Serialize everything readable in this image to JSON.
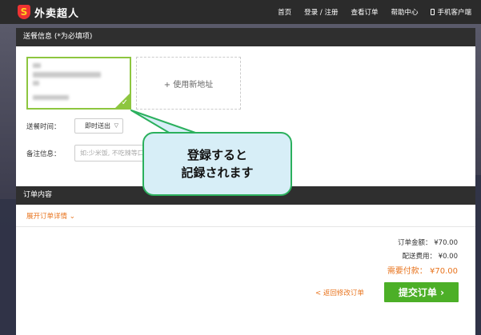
{
  "header": {
    "logo_glyph": "S",
    "logo_text": "外卖超人",
    "nav": [
      "首页",
      "登录 / 注册",
      "查看订单",
      "帮助中心",
      "手机客户端"
    ]
  },
  "delivery": {
    "section_title": "送餐信息 (*为必填项)",
    "new_address": "+ 使用新地址",
    "time_label": "送餐时间：",
    "time_value": "即时送出",
    "remark_label": "备注信息：",
    "remark_placeholder": "如:少米饭, 不吃辣等口"
  },
  "order": {
    "section_title": "订单内容",
    "expand_link": "展开订单详情",
    "total_label": "订单金额：",
    "total_value": "¥70.00",
    "delivery_fee_label": "配送费用：",
    "delivery_fee_value": "¥0.00",
    "payable_label": "需要付款：",
    "payable_value": "¥70.00",
    "back_link": "返回修改订单",
    "submit": "提交订单"
  },
  "callout": {
    "line1": "登録すると",
    "line2": "記録されます"
  },
  "colors": {
    "accent_green": "#8dc63f",
    "submit_green": "#4caf27",
    "orange": "#e8741e",
    "dark_header": "#2f2f2f"
  }
}
